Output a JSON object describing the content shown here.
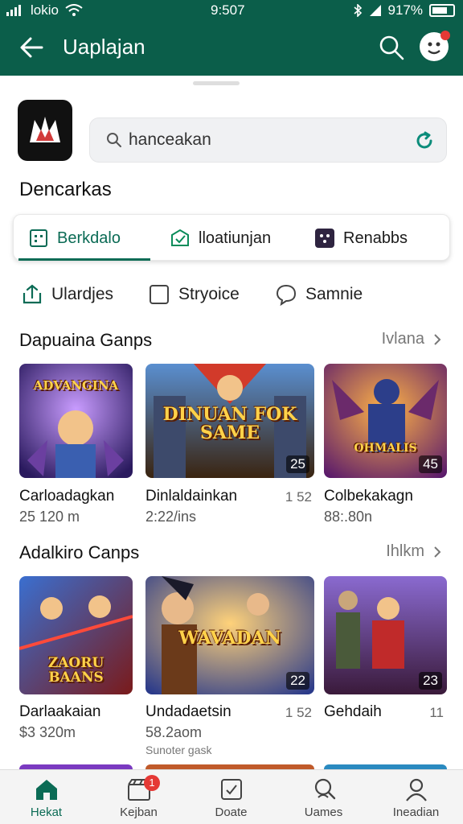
{
  "status_bar": {
    "carrier": "lokio",
    "time": "9:507",
    "battery": "917%"
  },
  "app_bar": {
    "title": "Uaplajan"
  },
  "search": {
    "value": "hanceakan",
    "placeholder": "hanceakan"
  },
  "section": {
    "title": "Dencarkas"
  },
  "tabs": [
    {
      "label": "Berkdalo",
      "icon": "grid-icon"
    },
    {
      "label": "lloatiunjan",
      "icon": "envelope-check-icon"
    },
    {
      "label": "Renabbs",
      "icon": "dots-square-icon"
    }
  ],
  "filters": [
    {
      "label": "Ulardjes",
      "icon": "share-icon"
    },
    {
      "label": "Stryoice",
      "icon": "checkbox-icon"
    },
    {
      "label": "Samnie",
      "icon": "chat-bubble-icon"
    }
  ],
  "rows": [
    {
      "title": "Dapuaina Ganps",
      "more": "Ivlana",
      "cards": [
        {
          "title": "Carloadagkan",
          "meta": "25 120 m",
          "count": "",
          "art_text": "ADVANGINA",
          "badge": ""
        },
        {
          "title": "Dinlaldainkan",
          "meta": "2:22/ins",
          "count": "1 52",
          "art_text": "DINUAN FOK SAME",
          "badge": "25"
        },
        {
          "title": "Colbekakagn",
          "meta": "88:.80n",
          "count": "",
          "art_text": "OHMALIS",
          "badge": "45"
        }
      ]
    },
    {
      "title": "Adalkiro Canps",
      "more": "Ihlkm",
      "cards": [
        {
          "title": "Darlaakaian",
          "meta": "$3 320m",
          "count": "",
          "art_text": "ZAORU BAANS",
          "badge": ""
        },
        {
          "title": "Undadaetsin",
          "meta": "58.2aom",
          "count": "1 52",
          "art_text": "WAVADAN",
          "badge": "22",
          "extra": "Sunoter gask"
        },
        {
          "title": "Gehdaih",
          "meta": "",
          "count": "11",
          "art_text": "",
          "badge": "23"
        }
      ]
    }
  ],
  "bottom_nav": [
    {
      "label": "Hekat",
      "icon": "home-icon",
      "active": true,
      "badge": ""
    },
    {
      "label": "Kejban",
      "icon": "clapperboard-icon",
      "active": false,
      "badge": "1"
    },
    {
      "label": "Doate",
      "icon": "edit-square-icon",
      "active": false,
      "badge": ""
    },
    {
      "label": "Uames",
      "icon": "search-person-icon",
      "active": false,
      "badge": ""
    },
    {
      "label": "Ineadian",
      "icon": "person-icon",
      "active": false,
      "badge": ""
    }
  ],
  "colors": {
    "primary": "#0b5e4a",
    "accent": "#0b6b55",
    "badge": "#e53935"
  }
}
